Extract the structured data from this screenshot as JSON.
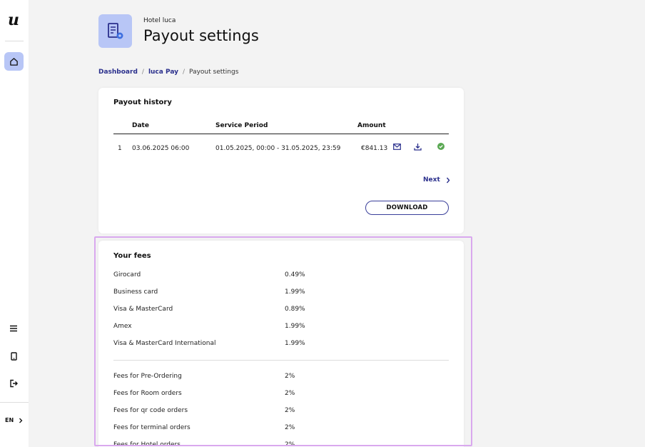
{
  "sidebar": {
    "logo": "u",
    "language": "EN"
  },
  "header": {
    "hotel_name": "Hotel luca",
    "title": "Payout settings"
  },
  "breadcrumb": {
    "dashboard": "Dashboard",
    "separator": "/",
    "luca_pay": "luca Pay",
    "current": "Payout settings"
  },
  "payout_history": {
    "title": "Payout history",
    "columns": {
      "date": "Date",
      "service_period": "Service Period",
      "amount": "Amount"
    },
    "rows": [
      {
        "index": "1",
        "date": "03.06.2025 06:00",
        "service_period": "01.05.2025, 00:00 - 31.05.2025, 23:59",
        "amount": "€841.13"
      }
    ],
    "next_label": "Next",
    "download_label": "DOWNLOAD"
  },
  "fees": {
    "title": "Your fees",
    "card_fees": [
      {
        "label": "Girocard",
        "value": "0.49%"
      },
      {
        "label": "Business card",
        "value": "1.99%"
      },
      {
        "label": "Visa & MasterCard",
        "value": "0.89%"
      },
      {
        "label": "Amex",
        "value": "1.99%"
      },
      {
        "label": "Visa & MasterCard International",
        "value": "1.99%"
      }
    ],
    "order_fees": [
      {
        "label": "Fees for Pre-Ordering",
        "value": "2%"
      },
      {
        "label": "Fees for Room orders",
        "value": "2%"
      },
      {
        "label": "Fees for qr code orders",
        "value": "2%"
      },
      {
        "label": "Fees for terminal orders",
        "value": "2%"
      },
      {
        "label": "Fees for Hotel orders",
        "value": "2%"
      }
    ]
  },
  "colors": {
    "accent": "#2a2f8c",
    "icon_bg": "#b8c6f6",
    "success": "#5aa853",
    "highlight": "#d9a8ee"
  }
}
